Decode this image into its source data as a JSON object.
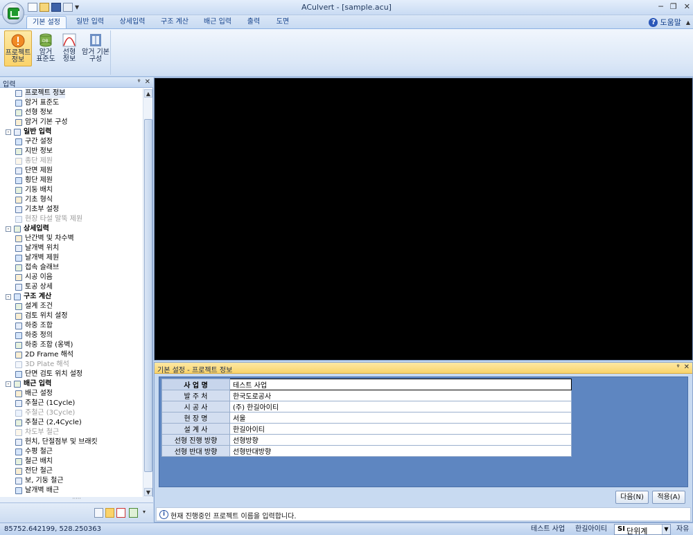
{
  "window": {
    "title": "ACulvert - [sample.acu]"
  },
  "ribbon": {
    "tabs": [
      "기본 설정",
      "일반 입력",
      "상세입력",
      "구조 계산",
      "배근 입력",
      "출력",
      "도면"
    ],
    "help_label": "도움말",
    "buttons": [
      {
        "label": "프로젝트\n정보",
        "icon": "project-info-icon"
      },
      {
        "label": "암거\n표준도",
        "icon": "database-icon"
      },
      {
        "label": "선형\n정보",
        "icon": "alignment-curve-icon"
      },
      {
        "label": "암거 기본\n구성",
        "icon": "culvert-frame-icon"
      }
    ]
  },
  "left_panel": {
    "title": "입력",
    "tree": [
      {
        "label": "프로젝트 정보",
        "level": 1,
        "state": "selected"
      },
      {
        "label": "암거 표준도",
        "level": 1
      },
      {
        "label": "선형 정보",
        "level": 1
      },
      {
        "label": "암거 기본 구성",
        "level": 1
      },
      {
        "label": "일반 입력",
        "level": 0,
        "expander": "-"
      },
      {
        "label": "구간 설정",
        "level": 1
      },
      {
        "label": "지반 정보",
        "level": 1
      },
      {
        "label": "종단 제원",
        "level": 1,
        "state": "disabled"
      },
      {
        "label": "단면 제원",
        "level": 1
      },
      {
        "label": "횡단 제원",
        "level": 1
      },
      {
        "label": "기둥 배치",
        "level": 1
      },
      {
        "label": "기초 형식",
        "level": 1
      },
      {
        "label": "기초부 설정",
        "level": 1
      },
      {
        "label": "현장 타설 말뚝 제원",
        "level": 1,
        "state": "disabled"
      },
      {
        "label": "상세입력",
        "level": 0,
        "expander": "-"
      },
      {
        "label": "난간벽 및 차수벽",
        "level": 1
      },
      {
        "label": "날개벽 위치",
        "level": 1
      },
      {
        "label": "날개벽 제원",
        "level": 1
      },
      {
        "label": "접속 슬래브",
        "level": 1
      },
      {
        "label": "시공 이음",
        "level": 1
      },
      {
        "label": "토공 상세",
        "level": 1
      },
      {
        "label": "구조 계산",
        "level": 0,
        "expander": "-"
      },
      {
        "label": "설계 조건",
        "level": 1
      },
      {
        "label": "검토 위치 설정",
        "level": 1
      },
      {
        "label": "하중 조합",
        "level": 1
      },
      {
        "label": "하중 정의",
        "level": 1
      },
      {
        "label": "하중 조합 (옹벽)",
        "level": 1
      },
      {
        "label": "2D Frame 해석",
        "level": 1
      },
      {
        "label": "3D Plate 해석",
        "level": 1,
        "state": "disabled"
      },
      {
        "label": "단면 검토 위치 설정",
        "level": 1
      },
      {
        "label": "배근 입력",
        "level": 0,
        "expander": "-"
      },
      {
        "label": "배근 설정",
        "level": 1
      },
      {
        "label": "주철근 (1Cycle)",
        "level": 1
      },
      {
        "label": "주철근 (3Cycle)",
        "level": 1,
        "state": "disabled"
      },
      {
        "label": "주철근 (2,4Cycle)",
        "level": 1
      },
      {
        "label": "차도부 철근",
        "level": 1,
        "state": "disabled"
      },
      {
        "label": "헌치, 단절점부 및 브래킷",
        "level": 1
      },
      {
        "label": "수평 철근",
        "level": 1
      },
      {
        "label": "철근 배치",
        "level": 1
      },
      {
        "label": "전단 철근",
        "level": 1
      },
      {
        "label": "보, 기둥 철근",
        "level": 1
      },
      {
        "label": "날개벽 배근",
        "level": 1
      }
    ],
    "footer_icons": [
      "tree-view-icon",
      "list-view-icon",
      "pdf-icon",
      "export-icon",
      "dropdown-icon"
    ]
  },
  "info_panel": {
    "title": "기본 설정 - 프로젝트 정보",
    "rows": [
      {
        "key": "사 업 명",
        "value": "테스트 사업"
      },
      {
        "key": "발 주 처",
        "value": "한국도로공사"
      },
      {
        "key": "시 공 사",
        "value": "(주) 한길아이티"
      },
      {
        "key": "현 장 명",
        "value": "서울"
      },
      {
        "key": "설 계 사",
        "value": "한길아이티"
      },
      {
        "key": "선형 진행 방향",
        "value": "선형방향"
      },
      {
        "key": "선형 반대 방향",
        "value": "선형반대방향"
      }
    ],
    "next_button": "다음(N)",
    "apply_button": "적용(A)",
    "hint": "현재 진행중인 프로젝트 이름을 입력합니다."
  },
  "status_bar": {
    "coords": "85752.642199,     528.250363",
    "project": "테스트 사업",
    "company": "한길아이티",
    "unit_prefix": "SI",
    "unit": "단위계",
    "mode": "자유"
  }
}
